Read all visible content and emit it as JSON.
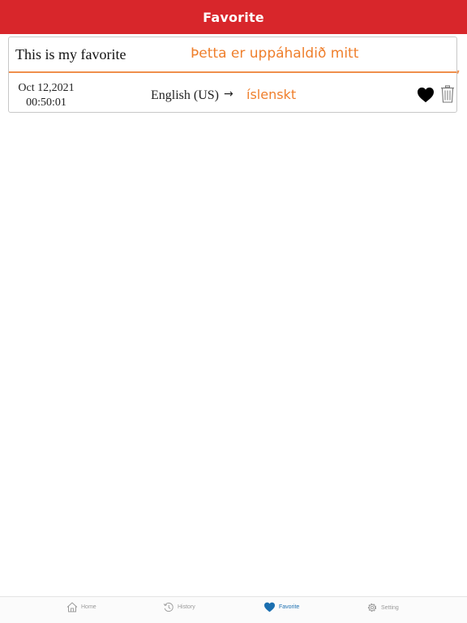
{
  "header": {
    "title": "Favorite"
  },
  "favorite_item": {
    "source_text": "This is my favorite",
    "translated_text": "Þetta er uppáhaldið mitt",
    "date": "Oct 12,2021",
    "time": "00:50:01",
    "source_language": "English (US)",
    "arrow": "→",
    "target_language": "íslenskt",
    "favorite_icon": "heart-filled-icon",
    "delete_icon": "trash-icon"
  },
  "tabs": [
    {
      "label": "Home",
      "icon": "home-icon",
      "active": false
    },
    {
      "label": "History",
      "icon": "history-icon",
      "active": false
    },
    {
      "label": "Favorite",
      "icon": "heart-icon",
      "active": true
    },
    {
      "label": "Setting",
      "icon": "gear-icon",
      "active": false
    }
  ],
  "colors": {
    "header_bg": "#d8262b",
    "accent_orange": "#ef7f2c",
    "tab_active": "#1b6fb0",
    "tab_inactive": "#9a9a9a"
  }
}
